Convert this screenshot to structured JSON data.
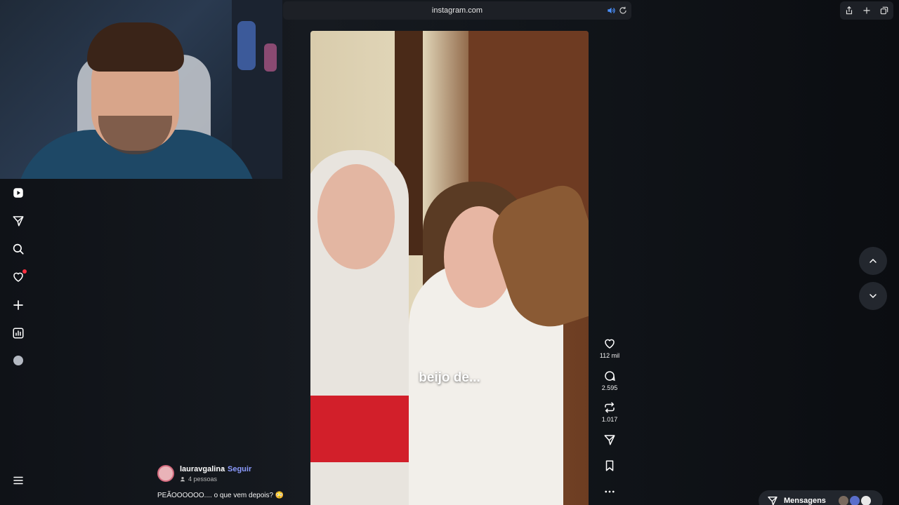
{
  "browser": {
    "url": "instagram.com"
  },
  "nav": {
    "items": [
      {
        "name": "reels-icon"
      },
      {
        "name": "send-icon"
      },
      {
        "name": "search-icon"
      },
      {
        "name": "heart-icon"
      },
      {
        "name": "plus-icon"
      },
      {
        "name": "insights-icon"
      },
      {
        "name": "profile-logo-icon"
      }
    ]
  },
  "video": {
    "caption": "beijo de..."
  },
  "actions": {
    "likes": "112 mil",
    "comments": "2.595",
    "reposts": "1.017"
  },
  "post": {
    "username": "lauravgalina",
    "separator": "•",
    "follow_label": "Seguir",
    "people": "4 pessoas",
    "caption": "PEÃOOOOOO.... o que vem depois? 😳"
  },
  "messages": {
    "label": "Mensagens"
  },
  "colors": {
    "notification": "#ff3040",
    "follow_link": "#8c9bff"
  }
}
